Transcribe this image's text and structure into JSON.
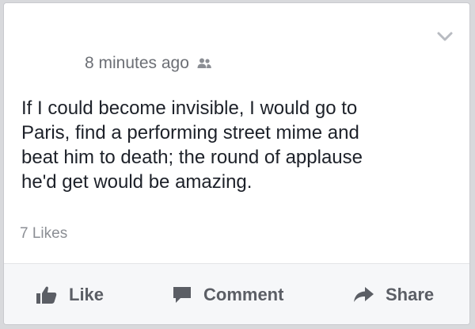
{
  "post": {
    "timestamp": "8 minutes ago",
    "audience_icon": "friends-icon",
    "text": "If I could become invisible, I would go to\nParis, find a performing street mime and\nbeat him to death; the round of applause\nhe'd get would be amazing.",
    "likes": "7 Likes",
    "menu_icon": "chevron-down-icon"
  },
  "actions": {
    "like": {
      "label": "Like",
      "icon": "thumbs-up-icon"
    },
    "comment": {
      "label": "Comment",
      "icon": "speech-bubble-icon"
    },
    "share": {
      "label": "Share",
      "icon": "share-arrow-icon"
    }
  },
  "colors": {
    "text": "#1d2129",
    "meta": "#6c6f75",
    "action": "#5b5e65",
    "action_bar": "#f6f7f9"
  }
}
